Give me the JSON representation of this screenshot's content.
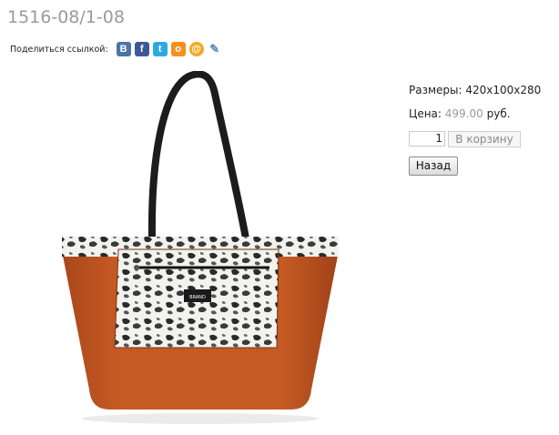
{
  "product": {
    "title": "1516-08/1-08",
    "image_alt": "handbag-photo",
    "brand_tag": "BRAND"
  },
  "share": {
    "label": "Поделиться ссылкой:",
    "icons": [
      {
        "name": "vkontakte-icon",
        "glyph": "В",
        "color": "#4c75a3"
      },
      {
        "name": "facebook-icon",
        "glyph": "f",
        "color": "#3b5998"
      },
      {
        "name": "twitter-icon",
        "glyph": "t",
        "color": "#2fa8e1"
      },
      {
        "name": "odnoklassniki-icon",
        "glyph": "o",
        "color": "#f4911e"
      },
      {
        "name": "mailru-icon",
        "glyph": "@",
        "color": "#f0a81c"
      },
      {
        "name": "livejournal-icon",
        "glyph": "✎",
        "color": "#5e8dbd"
      }
    ]
  },
  "details": {
    "size_label": "Размеры:",
    "size_value": "420x100x280",
    "price_label": "Цена:",
    "price_value": "499.00",
    "currency": "руб."
  },
  "cart": {
    "quantity": "1",
    "add_label": "В корзину",
    "back_label": "Назад"
  }
}
